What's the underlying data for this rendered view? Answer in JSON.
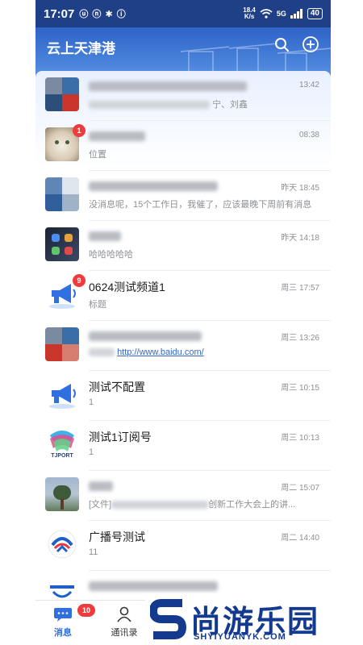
{
  "status_bar": {
    "time": "17:07",
    "left_icons": "ⓤ ⓝ ✱ ⓘ",
    "net_speed_value": "18.4",
    "net_speed_unit": "K/s",
    "signal": "5G",
    "battery": "40"
  },
  "header": {
    "title": "云上天津港",
    "search_icon": "search-icon",
    "add_icon": "plus-circle-icon"
  },
  "chats": [
    {
      "title_prefix": "",
      "title_suffix": "",
      "subtitle_prefix": "",
      "subtitle_suffix": "宁、刘鑫",
      "time": "13:42",
      "badge": "",
      "avatar": "group-photo"
    },
    {
      "title_prefix": "",
      "title_suffix": "",
      "subtitle_prefix": "位置",
      "subtitle_suffix": "",
      "time": "08:38",
      "badge": "1",
      "avatar": "cat-photo"
    },
    {
      "title_prefix": "",
      "title_suffix": "",
      "subtitle_prefix": "没消息呢，15个工作日，我催了，应该最晚下周前有消息",
      "subtitle_suffix": "",
      "time": "昨天 18:45",
      "badge": "",
      "avatar": "group-photo"
    },
    {
      "title_prefix": "",
      "title_suffix": "",
      "subtitle_prefix": "哈哈哈哈哈",
      "subtitle_suffix": "",
      "time": "昨天 14:18",
      "badge": "",
      "avatar": "phone-photo"
    },
    {
      "title_prefix": "0624测试频道1",
      "title_suffix": "",
      "subtitle_prefix": "标题",
      "subtitle_suffix": "",
      "time": "周三 17:57",
      "badge": "9",
      "avatar": "megaphone"
    },
    {
      "title_prefix": "",
      "title_suffix": "",
      "subtitle_prefix": "",
      "subtitle_suffix": "http://www.baidu.com/",
      "time": "周三 13:26",
      "badge": "",
      "avatar": "group-photo"
    },
    {
      "title_prefix": "测试不配置",
      "title_suffix": "",
      "subtitle_prefix": "1",
      "subtitle_suffix": "",
      "time": "周三 10:15",
      "badge": "",
      "avatar": "megaphone"
    },
    {
      "title_prefix": "测试1订阅号",
      "title_suffix": "",
      "subtitle_prefix": "1",
      "subtitle_suffix": "",
      "time": "周三 10:13",
      "badge": "",
      "avatar": "tjport-logo"
    },
    {
      "title_prefix": "",
      "title_suffix": "",
      "subtitle_prefix": "[文件]",
      "subtitle_suffix": "创新工作大会上的讲...",
      "time": "周二 15:07",
      "badge": "",
      "avatar": "tree-photo"
    },
    {
      "title_prefix": "广播号测试",
      "title_suffix": "",
      "subtitle_prefix": "11",
      "subtitle_suffix": "",
      "time": "周二 14:40",
      "badge": "",
      "avatar": "broadcast-logo"
    },
    {
      "title_prefix": "",
      "title_suffix": "",
      "subtitle_prefix": "",
      "subtitle_suffix": "",
      "time": "",
      "badge": "",
      "avatar": "port-logo"
    }
  ],
  "tjport_label": "TJPORT",
  "tabbar": {
    "messages_label": "消息",
    "messages_badge": "10",
    "contacts_label": "通讯录"
  },
  "watermark": {
    "text": "尚游乐园",
    "sub": "SHYIYUANYK.COM"
  },
  "colors": {
    "header_blue": "#2f63c8",
    "badge_red": "#ef3b3b",
    "link_blue": "#3366cc",
    "active_tab": "#2f6fe0",
    "watermark_blue": "#143a8f"
  }
}
